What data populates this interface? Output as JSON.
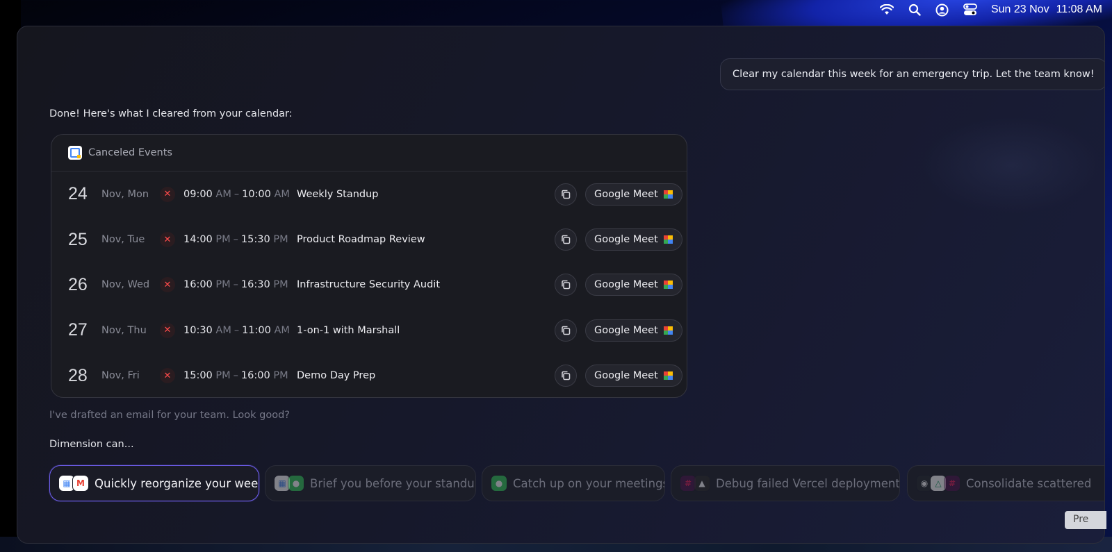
{
  "menubar": {
    "date": "Sun 23 Nov",
    "time": "11:08 AM",
    "icons": [
      "wifi-icon",
      "search-icon",
      "user-circle-icon",
      "control-center-icon"
    ]
  },
  "chat": {
    "user_message": "Clear my calendar this week for an emergency trip. Let the team know!",
    "assistant_reply": "Done! Here's what I cleared from your calendar:",
    "drafted_text": "I've drafted an email for your team. Look good?"
  },
  "card": {
    "title": "Canceled Events",
    "events": [
      {
        "day": "24",
        "date": "Nov, Mon",
        "start": "09:00",
        "start_mer": "AM",
        "end": "10:00",
        "end_mer": "AM",
        "title": "Weekly Standup",
        "meet_label": "Google Meet"
      },
      {
        "day": "25",
        "date": "Nov, Tue",
        "start": "14:00",
        "start_mer": "PM",
        "end": "15:30",
        "end_mer": "PM",
        "title": "Product Roadmap Review",
        "meet_label": "Google Meet"
      },
      {
        "day": "26",
        "date": "Nov, Wed",
        "start": "16:00",
        "start_mer": "PM",
        "end": "16:30",
        "end_mer": "PM",
        "title": "Infrastructure Security Audit",
        "meet_label": "Google Meet"
      },
      {
        "day": "27",
        "date": "Nov, Thu",
        "start": "10:30",
        "start_mer": "AM",
        "end": "11:00",
        "end_mer": "AM",
        "title": "1-on-1 with Marshall",
        "meet_label": "Google Meet"
      },
      {
        "day": "28",
        "date": "Nov, Fri",
        "start": "15:00",
        "start_mer": "PM",
        "end": "16:00",
        "end_mer": "PM",
        "title": "Demo Day Prep",
        "meet_label": "Google Meet"
      }
    ]
  },
  "suggestions": {
    "label": "Dimension can...",
    "chips": [
      {
        "label": "Quickly reorganize your week",
        "active": true,
        "icons": [
          "google-calendar-icon",
          "gmail-icon"
        ]
      },
      {
        "label": "Brief you before your standup",
        "active": false,
        "icons": [
          "google-calendar-icon",
          "messages-icon"
        ]
      },
      {
        "label": "Catch up on your meetings",
        "active": false,
        "icons": [
          "messages-icon"
        ]
      },
      {
        "label": "Debug failed Vercel deployments",
        "active": false,
        "icons": [
          "slack-icon",
          "vercel-icon"
        ]
      },
      {
        "label": "Consolidate scattered",
        "active": false,
        "icons": [
          "github-icon",
          "google-drive-icon",
          "slack-icon"
        ]
      }
    ]
  },
  "overlay": {
    "tab_label": "Pre"
  },
  "colors": {
    "accent": "#6c5ce7",
    "cancel_red": "#ff4b4b"
  }
}
